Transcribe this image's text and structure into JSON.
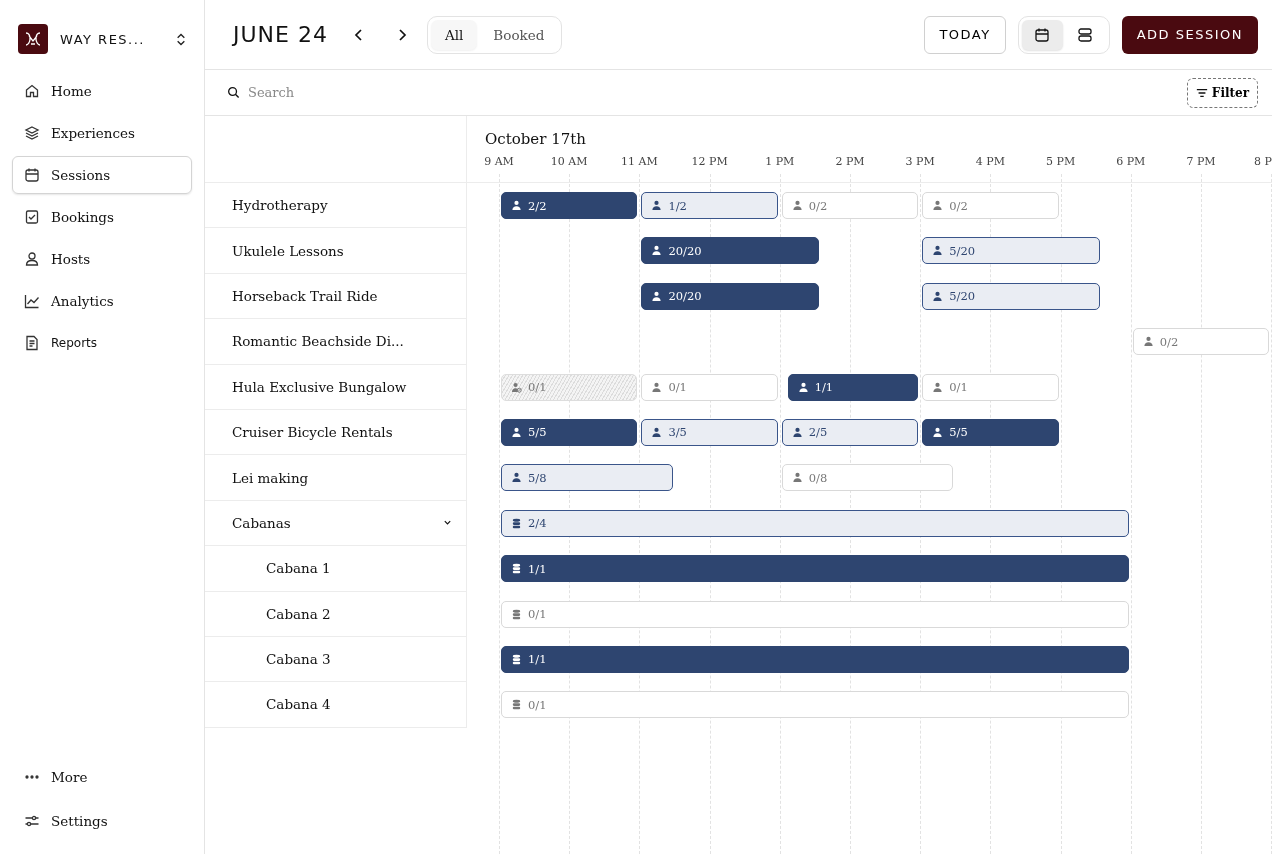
{
  "sidebar": {
    "workspace": "WAY RES...",
    "items": [
      {
        "label": "Home",
        "selected": false
      },
      {
        "label": "Experiences",
        "selected": false
      },
      {
        "label": "Sessions",
        "selected": true
      },
      {
        "label": "Bookings",
        "selected": false
      },
      {
        "label": "Hosts",
        "selected": false
      },
      {
        "label": "Analytics",
        "selected": false
      },
      {
        "label": "Reports",
        "selected": false
      }
    ],
    "footer": [
      {
        "label": "More"
      },
      {
        "label": "Settings"
      }
    ]
  },
  "toolbar": {
    "title": "JUNE 24",
    "filters": [
      {
        "label": "All",
        "selected": true
      },
      {
        "label": "Booked",
        "selected": false
      }
    ],
    "today": "TODAY",
    "views": [
      {
        "selected": true
      },
      {
        "selected": false
      }
    ],
    "add": "ADD SESSION"
  },
  "search": {
    "placeholder": "Search",
    "filter": "Filter"
  },
  "timeline": {
    "date": "October 17th",
    "hours": [
      "9 AM",
      "10 AM",
      "11 AM",
      "12 PM",
      "1 PM",
      "2 PM",
      "3 PM",
      "4 PM",
      "5 PM",
      "6 PM",
      "7 PM",
      "8 P"
    ]
  },
  "rows": [
    {
      "name": "Hydrotherapy",
      "sessions": [
        {
          "count": "2/2",
          "kind": "booked"
        },
        {
          "count": "1/2",
          "kind": "partial"
        },
        {
          "count": "0/2",
          "kind": "open"
        },
        {
          "count": "0/2",
          "kind": "open"
        }
      ]
    },
    {
      "name": "Ukulele Lessons",
      "sessions": [
        {
          "count": "20/20",
          "kind": "booked"
        },
        {
          "count": "5/20",
          "kind": "partial"
        }
      ]
    },
    {
      "name": "Horseback Trail Ride",
      "sessions": [
        {
          "count": "20/20",
          "kind": "booked"
        },
        {
          "count": "5/20",
          "kind": "partial"
        }
      ]
    },
    {
      "name": "Romantic Beachside Di...",
      "sessions": [
        {
          "count": "0/2",
          "kind": "open"
        }
      ]
    },
    {
      "name": "Hula Exclusive Bungalow",
      "sessions": [
        {
          "count": "0/1",
          "kind": "blocked"
        },
        {
          "count": "0/1",
          "kind": "open"
        },
        {
          "count": "1/1",
          "kind": "booked"
        },
        {
          "count": "0/1",
          "kind": "open"
        }
      ]
    },
    {
      "name": "Cruiser Bicycle Rentals",
      "sessions": [
        {
          "count": "5/5",
          "kind": "booked"
        },
        {
          "count": "3/5",
          "kind": "partial"
        },
        {
          "count": "2/5",
          "kind": "partial"
        },
        {
          "count": "5/5",
          "kind": "booked"
        }
      ]
    },
    {
      "name": "Lei making",
      "sessions": [
        {
          "count": "5/8",
          "kind": "partial"
        },
        {
          "count": "0/8",
          "kind": "open"
        }
      ]
    },
    {
      "name": "Cabanas",
      "expanded": true,
      "sessions": [
        {
          "count": "2/4",
          "kind": "partial"
        }
      ],
      "children": [
        {
          "name": "Cabana 1",
          "sessions": [
            {
              "count": "1/1",
              "kind": "booked"
            }
          ]
        },
        {
          "name": "Cabana 2",
          "sessions": [
            {
              "count": "0/1",
              "kind": "open"
            }
          ]
        },
        {
          "name": "Cabana 3",
          "sessions": [
            {
              "count": "1/1",
              "kind": "booked"
            }
          ]
        },
        {
          "name": "Cabana 4",
          "sessions": [
            {
              "count": "0/1",
              "kind": "open"
            }
          ]
        }
      ]
    }
  ]
}
